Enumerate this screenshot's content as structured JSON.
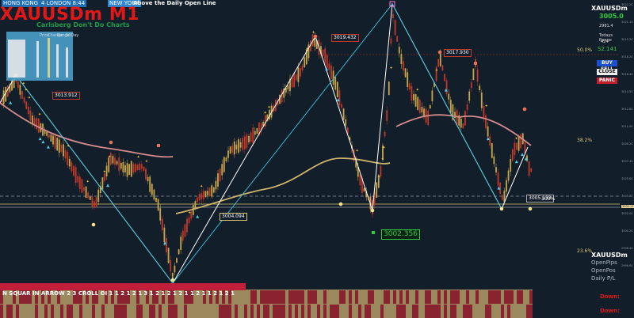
{
  "session_bar": {
    "hong_kong": "HONG KONG",
    "london": "4 LONDON",
    "london_time": "8:44",
    "new_york": "NEW YORK",
    "daily_open_status": "Above the Daily Open Line"
  },
  "chart_title": "XAUUSDm M1",
  "chart_subtitle": "Carlsberg Don't Do Charts",
  "dashboard": {
    "headers": [
      "Price",
      "Change",
      "Range",
      "10Day"
    ]
  },
  "price_labels": {
    "high_a": "3019.432",
    "high_b": "3017.930",
    "mid": "3013.912",
    "low_a": "3004.094",
    "low_b": "3002.356",
    "current": "3005.133",
    "current_pct": "100%"
  },
  "fib_labels": [
    "50.0%",
    "38.2%",
    "23.6%"
  ],
  "bottom_toolbar": "N SQUAR IN ARROW 2 3 CROLL OI 1 1 2 1 2 1 3 1 2 1 2 1 2 1 1 2 1 1 2 1 2 1",
  "right_panel": {
    "symbol": "XAUUSDm",
    "price": "3005.0",
    "line1": "2981.4",
    "line2": "Todays Range",
    "line3": "424",
    "line4": "S2.141",
    "buy_sell": "BUY SELL",
    "close": "CLOSE",
    "panic": "PANIC"
  },
  "lower_right_panel": {
    "symbol": "XAUUSDm",
    "open_pips": "OpenPips",
    "open_pos": "OpenPos",
    "daily_pl": "Daily P/L"
  },
  "down_labels": [
    "Down:",
    "Down:"
  ],
  "price_axis": [
    "3022.20",
    "3021.10",
    "3019.30",
    "3018.20",
    "3016.40",
    "3014.55",
    "3012.80",
    "3011.00",
    "3009.20",
    "3007.40",
    "3005.60",
    "3003.80",
    "3002.00",
    "3000.20",
    "2998.40",
    "2996.60"
  ],
  "current_price_axis": "3005.13",
  "colors": {
    "background": "#131e2b",
    "bull_candle": "#c9a64a",
    "bear_candle": "#c0392b",
    "zigzag_white": "#ffffff",
    "zigzag_cyan": "#39c3d9",
    "ma_slow": "#d48a8a",
    "ma_fast": "#cdb36a"
  }
}
